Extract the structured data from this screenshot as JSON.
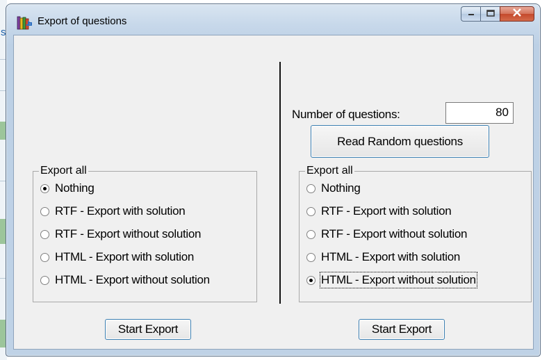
{
  "background": {
    "partial_letter": "s"
  },
  "window": {
    "title": "Export of questions",
    "buttons": {
      "minimize": "minimize",
      "maximize": "maximize",
      "close": "close"
    }
  },
  "left_panel": {
    "group_title": "Export all",
    "options": [
      {
        "label": "Nothing",
        "checked": true
      },
      {
        "label": "RTF - Export with solution",
        "checked": false
      },
      {
        "label": "RTF - Export without solution",
        "checked": false
      },
      {
        "label": "HTML - Export with solution",
        "checked": false
      },
      {
        "label": "HTML - Export without solution",
        "checked": false
      }
    ],
    "start_button": "Start Export"
  },
  "right_panel": {
    "number_label": "Number of questions:",
    "number_value": "80",
    "read_button": "Read Random questions",
    "group_title": "Export all",
    "options": [
      {
        "label": "Nothing",
        "checked": false
      },
      {
        "label": "RTF - Export with solution",
        "checked": false
      },
      {
        "label": "RTF - Export without solution",
        "checked": false
      },
      {
        "label": "HTML - Export with solution",
        "checked": false
      },
      {
        "label": "HTML - Export without solution",
        "checked": true
      }
    ],
    "start_button": "Start Export"
  },
  "colors": {
    "client_bg": "#f0f0f0",
    "button_border": "#3c7fb1",
    "close_button": "#c4492c"
  }
}
